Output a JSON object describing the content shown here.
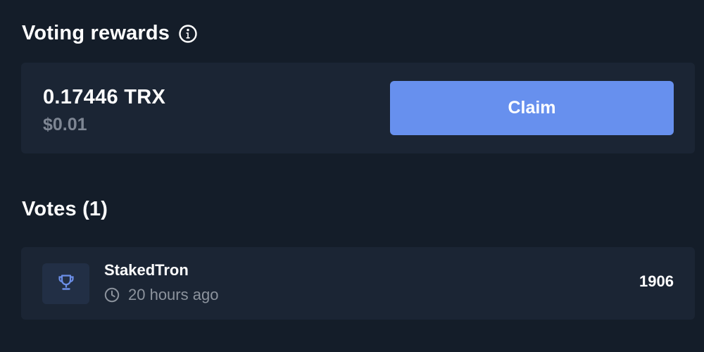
{
  "rewards": {
    "title": "Voting rewards",
    "info_icon": "info-icon",
    "amount": "0.17446 TRX",
    "fiat_value": "$0.01",
    "claim_label": "Claim"
  },
  "votes": {
    "title": "Votes (1)",
    "items": [
      {
        "icon": "trophy-icon",
        "name": "StakedTron",
        "time_icon": "clock-icon",
        "time": "20 hours ago",
        "count": "1906"
      }
    ]
  },
  "colors": {
    "background": "#141d29",
    "card": "#1b2534",
    "accent": "#6790ee",
    "muted_text": "#7e8693"
  }
}
